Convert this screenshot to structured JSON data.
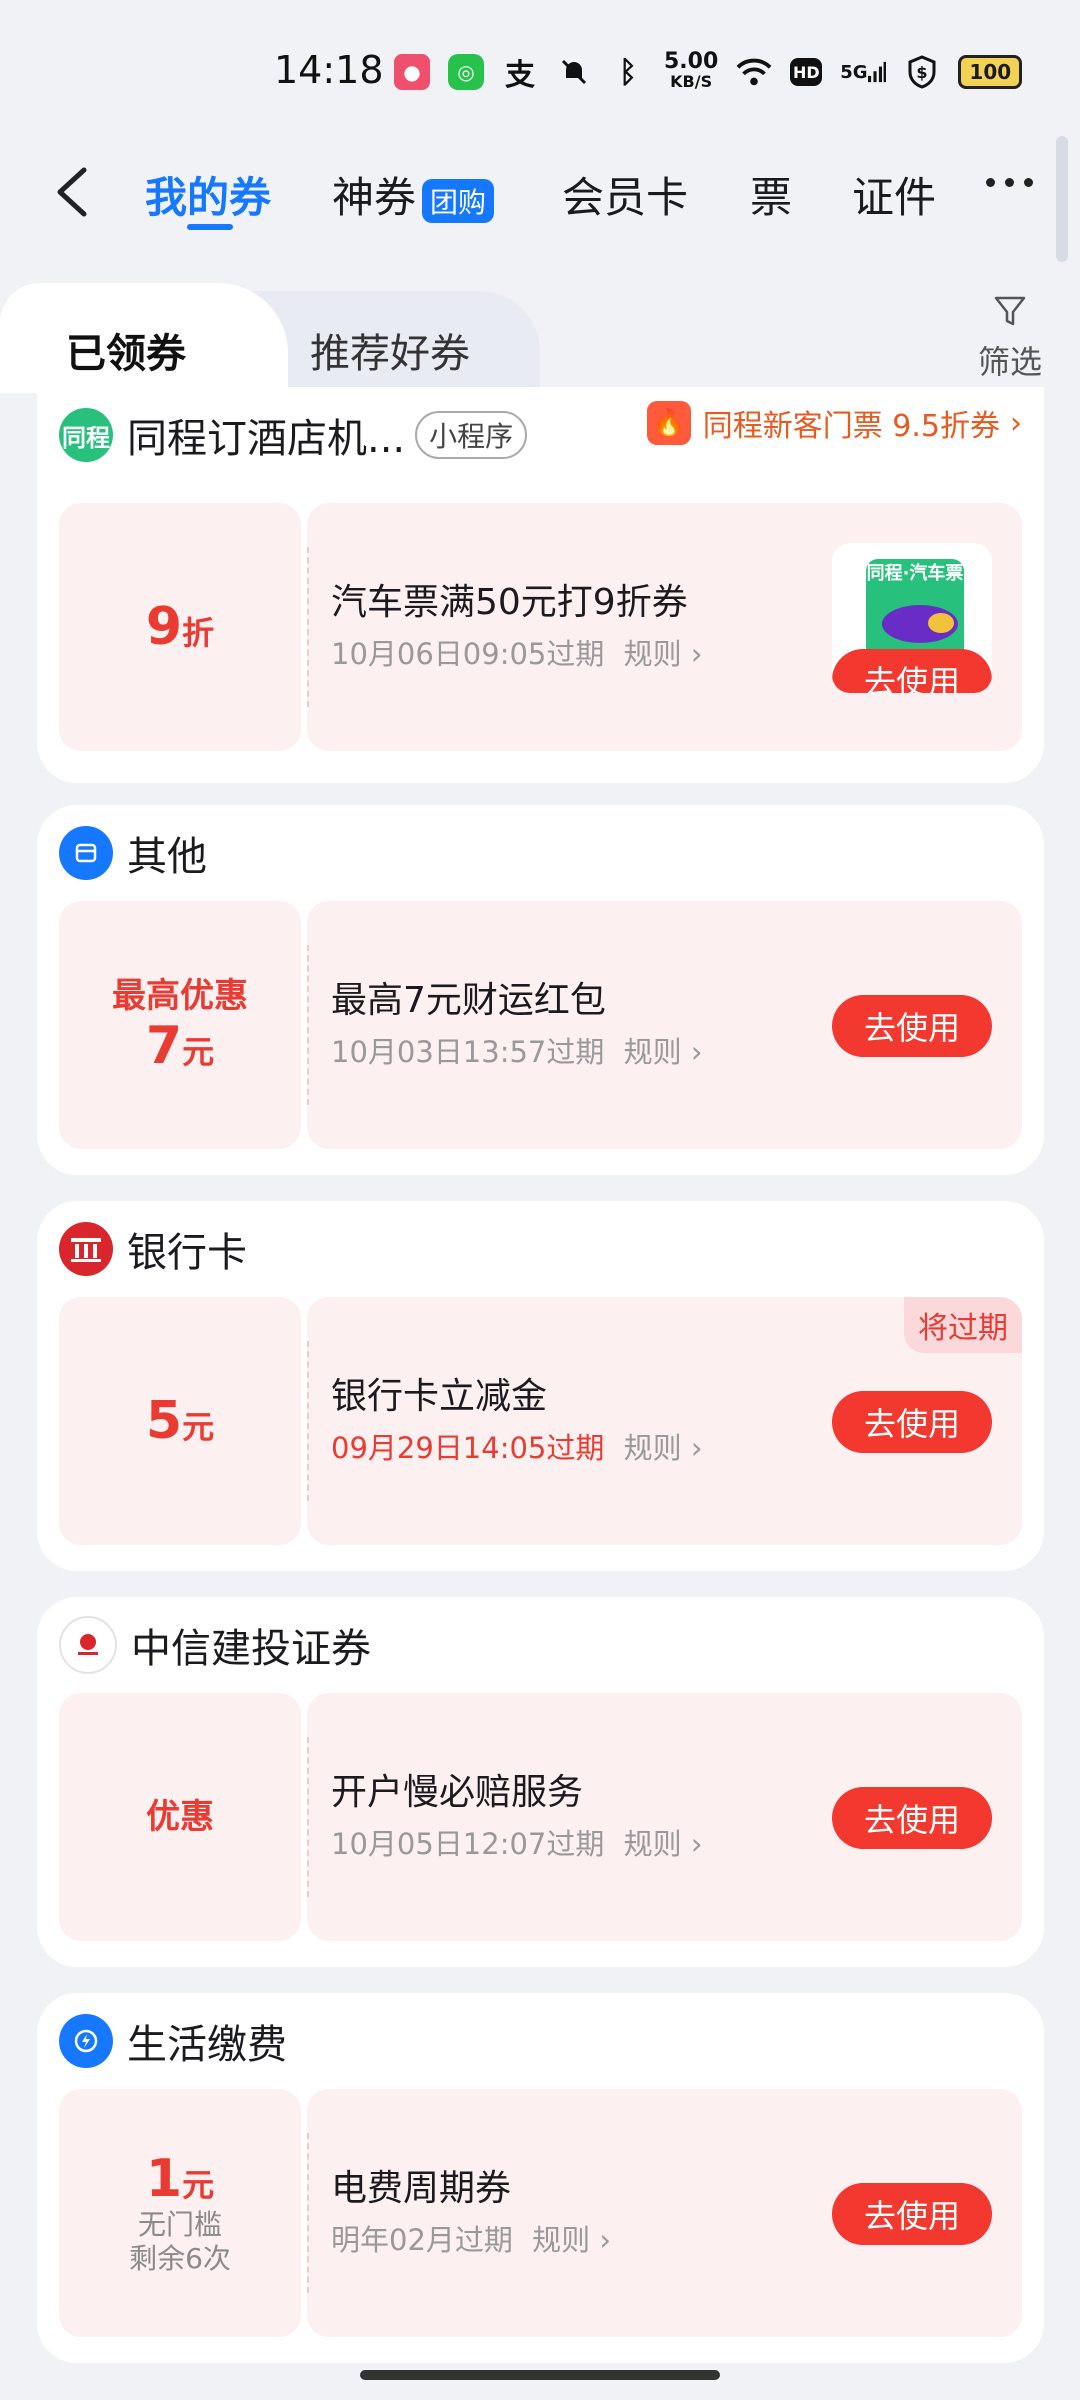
{
  "status_bar": {
    "time": "14:18",
    "net_speed": "5.00\nKB/S",
    "net_speed_value": "5.00",
    "net_speed_unit": "KB/S",
    "hd": "HD",
    "signal": "5G",
    "battery": "100"
  },
  "nav": {
    "tabs": [
      {
        "label": "我的券"
      },
      {
        "label": "神券",
        "badge": "团购"
      },
      {
        "label": "会员卡"
      },
      {
        "label": "票"
      },
      {
        "label": "证件"
      }
    ]
  },
  "subtabs": {
    "active": "已领券",
    "inactive": "推荐好券",
    "filter_label": "筛选"
  },
  "cards": [
    {
      "store": "同程订酒店机...",
      "store_badge": "小程序",
      "promo": "同程新客门票 9.5折券",
      "coupon": {
        "amount": "9",
        "unit": "折",
        "title": "汽车票满50元打9折券",
        "expire": "10月06日09:05过期",
        "rule": "规则",
        "button": "去使用",
        "thumb_text": "同程·汽车票"
      }
    },
    {
      "store": "其他",
      "coupon": {
        "label": "最高优惠",
        "amount": "7",
        "unit": "元",
        "title": "最高7元财运红包",
        "expire": "10月03日13:57过期",
        "rule": "规则",
        "button": "去使用"
      }
    },
    {
      "store": "银行卡",
      "coupon": {
        "amount": "5",
        "unit": "元",
        "title": "银行卡立减金",
        "expire": "09月29日14:05过期",
        "rule": "规则",
        "button": "去使用",
        "tag": "将过期"
      }
    },
    {
      "store": "中信建投证券",
      "coupon": {
        "label": "优惠",
        "title": "开户慢必赔服务",
        "expire": "10月05日12:07过期",
        "rule": "规则",
        "button": "去使用"
      }
    },
    {
      "store": "生活缴费",
      "coupon": {
        "amount": "1",
        "unit": "元",
        "sub1": "无门槛",
        "sub2": "剩余6次",
        "title": "电费周期券",
        "expire": "明年02月过期",
        "rule": "规则",
        "button": "去使用"
      }
    }
  ],
  "colors": {
    "accent_blue": "#1677ff",
    "coupon_red": "#f2382f",
    "coupon_bg": "#fdf0f1",
    "page_bg": "#f1f2f6"
  },
  "icons": [
    "back-icon",
    "filter-icon",
    "fire-icon",
    "box-icon",
    "bank-icon",
    "citic-logo-icon",
    "lightning-icon",
    "more-icon"
  ]
}
